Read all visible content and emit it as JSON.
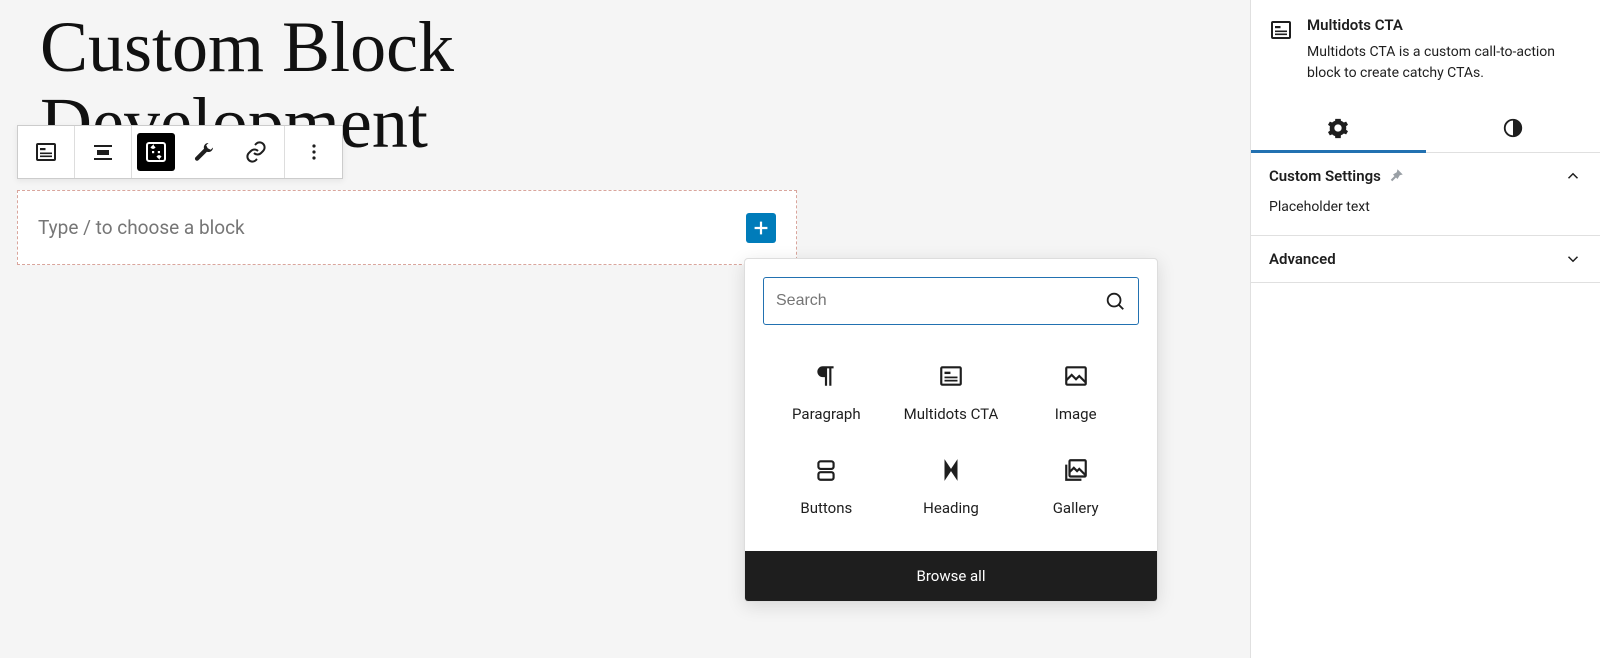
{
  "editor": {
    "page_title": "Custom Block Development",
    "placeholder": "Type / to choose a block"
  },
  "toolbar": {
    "items": [
      {
        "name": "block-type-icon"
      },
      {
        "name": "align-icon"
      },
      {
        "name": "move-icon"
      },
      {
        "name": "settings-icon"
      },
      {
        "name": "link-icon"
      },
      {
        "name": "more-icon"
      }
    ]
  },
  "inserter": {
    "search_placeholder": "Search",
    "browse_all": "Browse all",
    "blocks": [
      {
        "label": "Paragraph",
        "icon": "paragraph-icon"
      },
      {
        "label": "Multidots CTA",
        "icon": "cta-icon"
      },
      {
        "label": "Image",
        "icon": "image-icon"
      },
      {
        "label": "Buttons",
        "icon": "buttons-icon"
      },
      {
        "label": "Heading",
        "icon": "heading-icon"
      },
      {
        "label": "Gallery",
        "icon": "gallery-icon"
      }
    ]
  },
  "sidebar": {
    "block_title": "Multidots CTA",
    "block_desc": "Multidots CTA is a custom call-to-action block to create catchy CTAs.",
    "panels": {
      "custom": {
        "title": "Custom Settings",
        "field_label": "Placeholder text"
      },
      "advanced": {
        "title": "Advanced"
      }
    }
  }
}
